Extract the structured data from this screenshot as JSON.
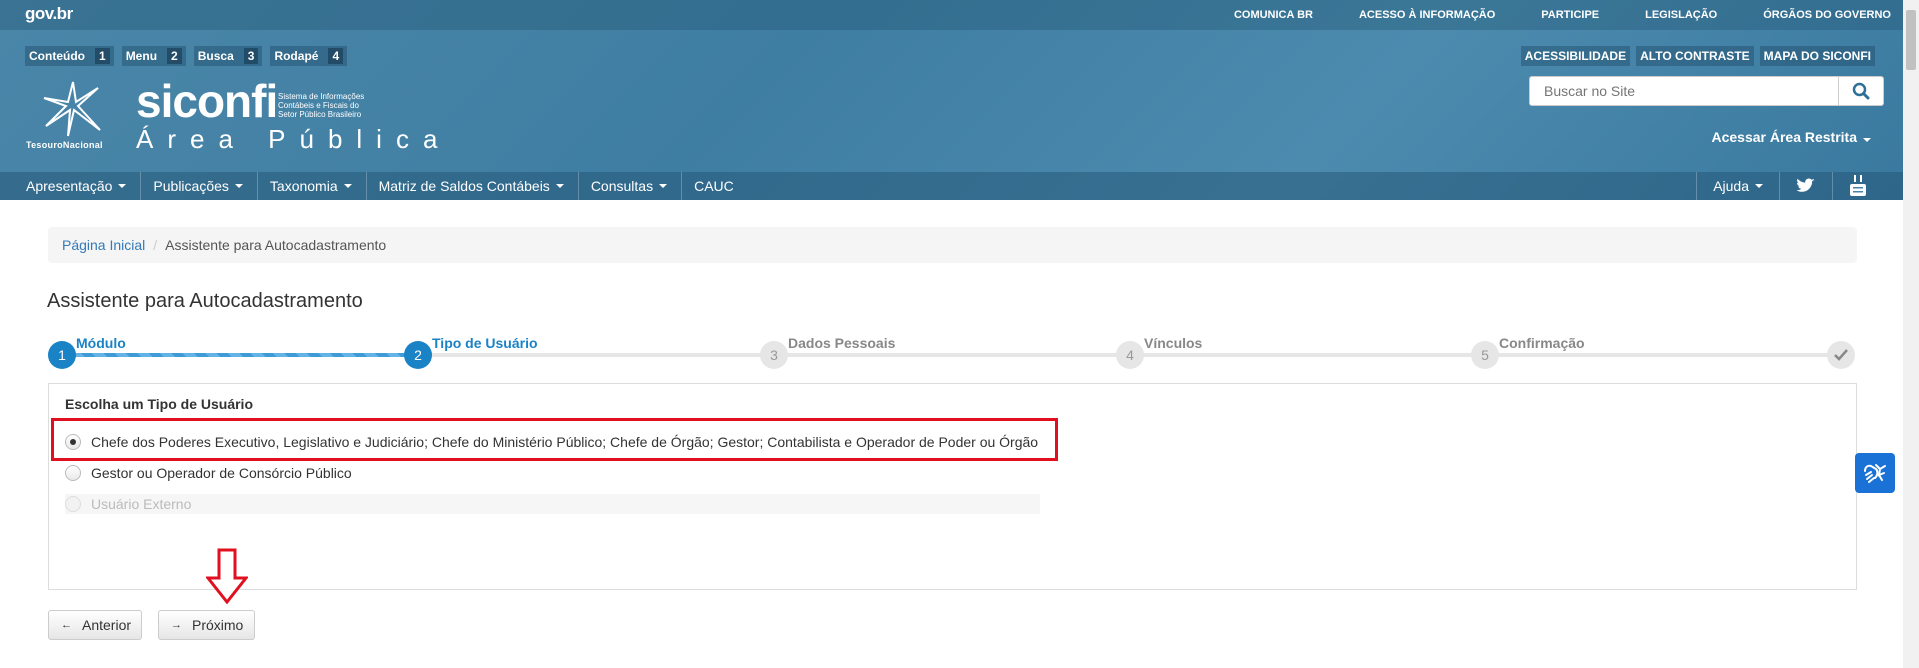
{
  "topbar": {
    "brand": "gov.br",
    "links": [
      "COMUNICA BR",
      "ACESSO À INFORMAÇÃO",
      "PARTICIPE",
      "LEGISLAÇÃO",
      "ÓRGÃOS DO GOVERNO"
    ]
  },
  "skip_links": [
    {
      "label": "Conteúdo",
      "key": "1"
    },
    {
      "label": "Menu",
      "key": "2"
    },
    {
      "label": "Busca",
      "key": "3"
    },
    {
      "label": "Rodapé",
      "key": "4"
    }
  ],
  "accessibility_links": [
    "ACESSIBILIDADE",
    "ALTO CONTRASTE",
    "MAPA DO SICONFI"
  ],
  "search": {
    "placeholder": "Buscar no Site"
  },
  "login_label": "Acessar Área Restrita",
  "logo": {
    "tesouro": "TesouroNacional",
    "name": "siconfi",
    "subtitle_line1": "Sistema de Informações",
    "subtitle_line2": "Contábeis e Fiscais do",
    "subtitle_line3": "Setor Público Brasileiro",
    "area": "Área Pública"
  },
  "nav": {
    "items": [
      {
        "label": "Apresentação",
        "dropdown": true
      },
      {
        "label": "Publicações",
        "dropdown": true
      },
      {
        "label": "Taxonomia",
        "dropdown": true
      },
      {
        "label": "Matriz de Saldos Contábeis",
        "dropdown": true
      },
      {
        "label": "Consultas",
        "dropdown": true
      },
      {
        "label": "CAUC",
        "dropdown": false
      }
    ],
    "help": "Ajuda"
  },
  "breadcrumb": {
    "home": "Página Inicial",
    "current": "Assistente para Autocadastramento"
  },
  "page_title": "Assistente para Autocadastramento",
  "wizard": {
    "steps": [
      {
        "num": "1",
        "label": "Módulo",
        "state": "done"
      },
      {
        "num": "2",
        "label": "Tipo de Usuário",
        "state": "active"
      },
      {
        "num": "3",
        "label": "Dados Pessoais",
        "state": "pending"
      },
      {
        "num": "4",
        "label": "Vínculos",
        "state": "pending"
      },
      {
        "num": "5",
        "label": "Confirmação",
        "state": "pending"
      }
    ]
  },
  "panel": {
    "title": "Escolha um Tipo de Usuário",
    "options": [
      {
        "label": "Chefe dos Poderes Executivo, Legislativo e Judiciário; Chefe do Ministério Público; Chefe de Órgão; Gestor; Contabilista e Operador de Poder ou Órgão",
        "checked": true,
        "disabled": false
      },
      {
        "label": "Gestor ou Operador de Consórcio Público",
        "checked": false,
        "disabled": false
      },
      {
        "label": "Usuário Externo",
        "checked": false,
        "disabled": true
      }
    ]
  },
  "buttons": {
    "previous": "Anterior",
    "next": "Próximo"
  },
  "colors": {
    "header": "#4583a8",
    "accent": "#1a83c6",
    "highlight": "#e01020",
    "libras": "#1a72d6"
  }
}
